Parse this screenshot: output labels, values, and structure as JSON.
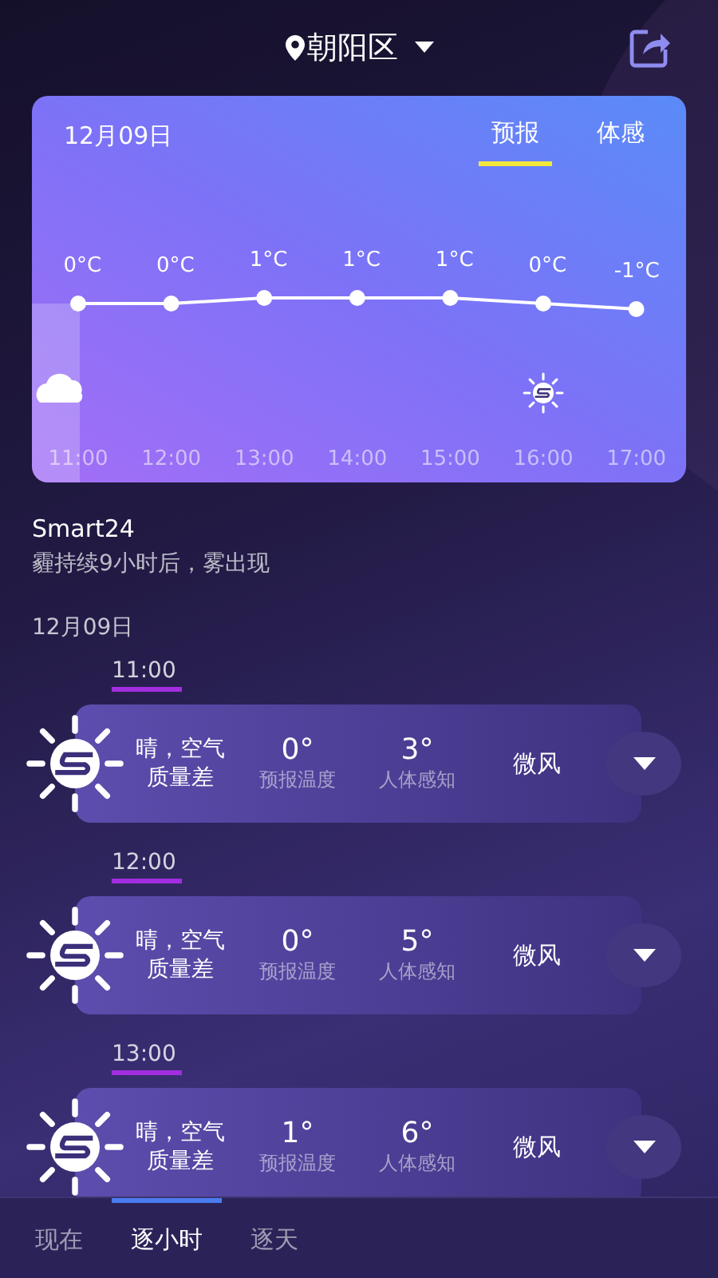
{
  "header": {
    "location": "朝阳区"
  },
  "forecast_card": {
    "date": "12月09日",
    "tabs": [
      {
        "label": "预报",
        "selected": true
      },
      {
        "label": "体感",
        "selected": false
      }
    ],
    "chart_data": {
      "type": "line",
      "categories": [
        "11:00",
        "12:00",
        "13:00",
        "14:00",
        "15:00",
        "16:00",
        "17:00"
      ],
      "series": [
        {
          "color": "#ffffff",
          "marker": "circle",
          "values": [
            0,
            0,
            1,
            1,
            1,
            0,
            -1
          ]
        }
      ],
      "data_labels": true
    },
    "units": [
      "°C",
      "°C",
      "°C",
      "°C",
      "°C",
      "°C",
      "°C"
    ],
    "columns": [
      {
        "kind": "cloud",
        "selected": true
      },
      {
        "kind": "plain",
        "selected": false
      },
      {
        "kind": "plain",
        "selected": false
      },
      {
        "kind": "plain",
        "selected": false
      },
      {
        "kind": "plain",
        "selected": false
      },
      {
        "kind": "sun",
        "selected": false
      },
      {
        "kind": "plain",
        "selected": false
      }
    ]
  },
  "summary": {
    "title": "Smart24",
    "text": "霾持续9小时后，雾出现"
  },
  "list_date": "12月09日",
  "hours": [
    {
      "time": "11:00",
      "condition": "晴，空气质量差",
      "forecast_temp": "0°",
      "forecast_label": "预报温度",
      "feel_temp": "3°",
      "feel_label": "人体感知",
      "wind": "微风",
      "expanded": false
    },
    {
      "time": "12:00",
      "condition": "晴，空气质量差",
      "forecast_temp": "0°",
      "forecast_label": "预报温度",
      "feel_temp": "5°",
      "feel_label": "人体感知",
      "wind": "微风",
      "expanded": false
    },
    {
      "time": "13:00",
      "condition": "晴，空气质量差",
      "forecast_temp": "1°",
      "forecast_label": "预报温度",
      "feel_temp": "6°",
      "feel_label": "人体感知",
      "wind": "微风",
      "expanded": false
    }
  ],
  "bottom_tabs": [
    {
      "label": "现在",
      "selected": false
    },
    {
      "label": "逐小时",
      "selected": true
    },
    {
      "label": "逐天",
      "selected": false
    }
  ]
}
